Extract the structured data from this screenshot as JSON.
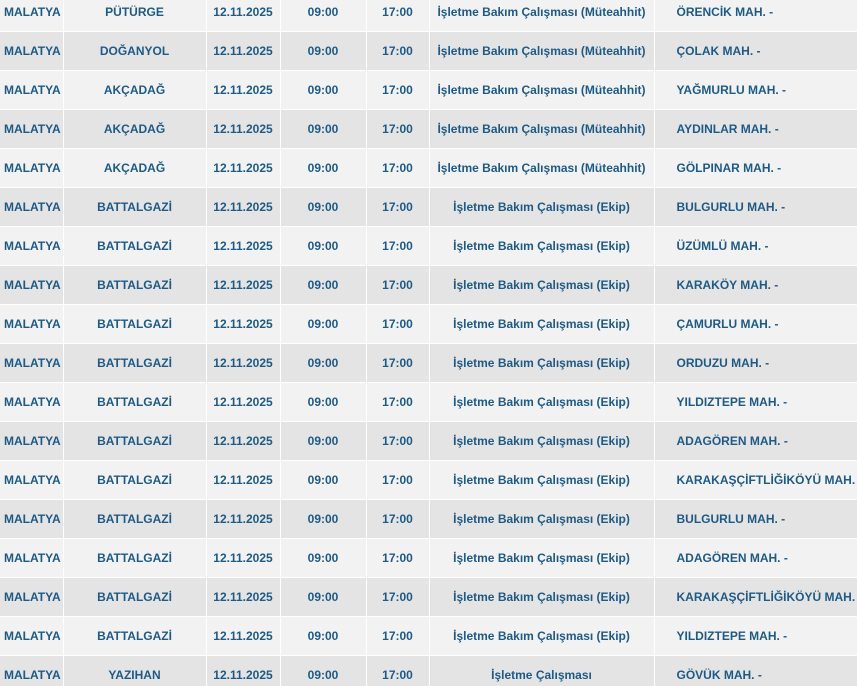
{
  "table": {
    "rows": [
      {
        "il": "MALATYA",
        "ilce": "PÜTÜRGE",
        "tarih": "12.11.2025",
        "baslangic": "09:00",
        "bitis": "17:00",
        "neden": "İşletme Bakım Çalışması (Müteahhit)",
        "mahalle": "ÖRENCİK MAH. -"
      },
      {
        "il": "MALATYA",
        "ilce": "DOĞANYOL",
        "tarih": "12.11.2025",
        "baslangic": "09:00",
        "bitis": "17:00",
        "neden": "İşletme Bakım Çalışması (Müteahhit)",
        "mahalle": "ÇOLAK MAH. -"
      },
      {
        "il": "MALATYA",
        "ilce": "AKÇADAĞ",
        "tarih": "12.11.2025",
        "baslangic": "09:00",
        "bitis": "17:00",
        "neden": "İşletme Bakım Çalışması (Müteahhit)",
        "mahalle": "YAĞMURLU MAH. -"
      },
      {
        "il": "MALATYA",
        "ilce": "AKÇADAĞ",
        "tarih": "12.11.2025",
        "baslangic": "09:00",
        "bitis": "17:00",
        "neden": "İşletme Bakım Çalışması (Müteahhit)",
        "mahalle": "AYDINLAR MAH. -"
      },
      {
        "il": "MALATYA",
        "ilce": "AKÇADAĞ",
        "tarih": "12.11.2025",
        "baslangic": "09:00",
        "bitis": "17:00",
        "neden": "İşletme Bakım Çalışması (Müteahhit)",
        "mahalle": "GÖLPINAR MAH. -"
      },
      {
        "il": "MALATYA",
        "ilce": "BATTALGAZİ",
        "tarih": "12.11.2025",
        "baslangic": "09:00",
        "bitis": "17:00",
        "neden": "İşletme Bakım Çalışması (Ekip)",
        "mahalle": "BULGURLU MAH. -"
      },
      {
        "il": "MALATYA",
        "ilce": "BATTALGAZİ",
        "tarih": "12.11.2025",
        "baslangic": "09:00",
        "bitis": "17:00",
        "neden": "İşletme Bakım Çalışması (Ekip)",
        "mahalle": "ÜZÜMLÜ MAH. -"
      },
      {
        "il": "MALATYA",
        "ilce": "BATTALGAZİ",
        "tarih": "12.11.2025",
        "baslangic": "09:00",
        "bitis": "17:00",
        "neden": "İşletme Bakım Çalışması (Ekip)",
        "mahalle": "KARAKÖY MAH. -"
      },
      {
        "il": "MALATYA",
        "ilce": "BATTALGAZİ",
        "tarih": "12.11.2025",
        "baslangic": "09:00",
        "bitis": "17:00",
        "neden": "İşletme Bakım Çalışması (Ekip)",
        "mahalle": "ÇAMURLU MAH. -"
      },
      {
        "il": "MALATYA",
        "ilce": "BATTALGAZİ",
        "tarih": "12.11.2025",
        "baslangic": "09:00",
        "bitis": "17:00",
        "neden": "İşletme Bakım Çalışması (Ekip)",
        "mahalle": "ORDUZU MAH. -"
      },
      {
        "il": "MALATYA",
        "ilce": "BATTALGAZİ",
        "tarih": "12.11.2025",
        "baslangic": "09:00",
        "bitis": "17:00",
        "neden": "İşletme Bakım Çalışması (Ekip)",
        "mahalle": "YILDIZTEPE MAH. -"
      },
      {
        "il": "MALATYA",
        "ilce": "BATTALGAZİ",
        "tarih": "12.11.2025",
        "baslangic": "09:00",
        "bitis": "17:00",
        "neden": "İşletme Bakım Çalışması (Ekip)",
        "mahalle": "ADAGÖREN MAH. -"
      },
      {
        "il": "MALATYA",
        "ilce": "BATTALGAZİ",
        "tarih": "12.11.2025",
        "baslangic": "09:00",
        "bitis": "17:00",
        "neden": "İşletme Bakım Çalışması (Ekip)",
        "mahalle": "KARAKAŞÇİFTLİĞİKÖYÜ MAH. -"
      },
      {
        "il": "MALATYA",
        "ilce": "BATTALGAZİ",
        "tarih": "12.11.2025",
        "baslangic": "09:00",
        "bitis": "17:00",
        "neden": "İşletme Bakım Çalışması (Ekip)",
        "mahalle": "BULGURLU MAH. -"
      },
      {
        "il": "MALATYA",
        "ilce": "BATTALGAZİ",
        "tarih": "12.11.2025",
        "baslangic": "09:00",
        "bitis": "17:00",
        "neden": "İşletme Bakım Çalışması (Ekip)",
        "mahalle": "ADAGÖREN MAH. -"
      },
      {
        "il": "MALATYA",
        "ilce": "BATTALGAZİ",
        "tarih": "12.11.2025",
        "baslangic": "09:00",
        "bitis": "17:00",
        "neden": "İşletme Bakım Çalışması (Ekip)",
        "mahalle": "KARAKAŞÇİFTLİĞİKÖYÜ MAH. -"
      },
      {
        "il": "MALATYA",
        "ilce": "BATTALGAZİ",
        "tarih": "12.11.2025",
        "baslangic": "09:00",
        "bitis": "17:00",
        "neden": "İşletme Bakım Çalışması (Ekip)",
        "mahalle": "YILDIZTEPE MAH. -"
      },
      {
        "il": "MALATYA",
        "ilce": "YAZIHAN",
        "tarih": "12.11.2025",
        "baslangic": "09:00",
        "bitis": "17:00",
        "neden": "İşletme Çalışması",
        "mahalle": "GÖVÜK MAH. -"
      }
    ]
  },
  "colors": {
    "text": "#1e5a86",
    "row_light": "#f2f2f2",
    "row_dark": "#e4e4e4"
  }
}
